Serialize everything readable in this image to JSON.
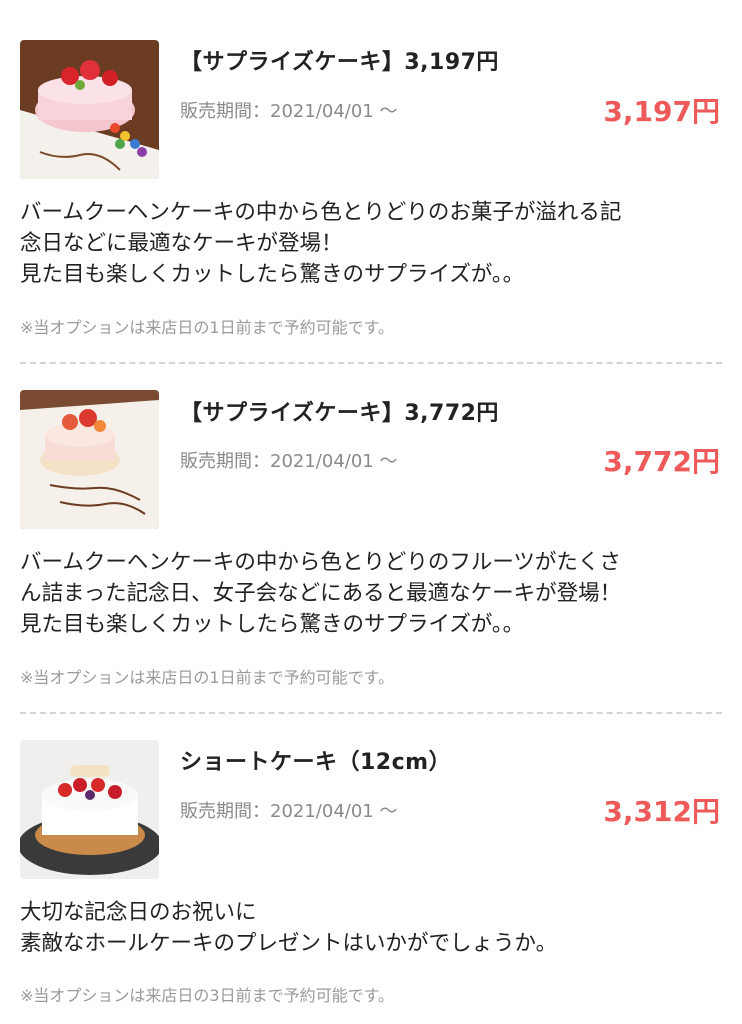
{
  "items": [
    {
      "title": "【サプライズケーキ】3,197円",
      "period": "販売期間：2021/04/01 〜",
      "price": "3,197円",
      "desc": [
        "バームクーヘンケーキの中から色とりどりのお菓子が溢れる記",
        "念日などに最適なケーキが登場！",
        "見た目も楽しくカットしたら驚きのサプライズが。。"
      ],
      "note": "※当オプションは来店日の1日前まで予約可能です。",
      "image_icon": "cake-photo"
    },
    {
      "title": "【サプライズケーキ】3,772円",
      "period": "販売期間：2021/04/01 〜",
      "price": "3,772円",
      "desc": [
        "バームクーヘンケーキの中から色とりどりのフルーツがたくさ",
        "ん詰まった記念日、女子会などにあると最適なケーキが登場！",
        "見た目も楽しくカットしたら驚きのサプライズが。。"
      ],
      "note": "※当オプションは来店日の1日前まで予約可能です。",
      "image_icon": "cake-photo"
    },
    {
      "title": "ショートケーキ（12cm）",
      "period": "販売期間：2021/04/01 〜",
      "price": "3,312円",
      "desc": [
        "大切な記念日のお祝いに",
        "素敵なホールケーキのプレゼントはいかがでしょうか。"
      ],
      "note": "※当オプションは来店日の3日前まで予約可能です。",
      "image_icon": "cake-photo"
    }
  ],
  "colors": {
    "price": "#ee5a5a",
    "muted": "#8a8a8a",
    "divider": "#d4d4d4"
  }
}
